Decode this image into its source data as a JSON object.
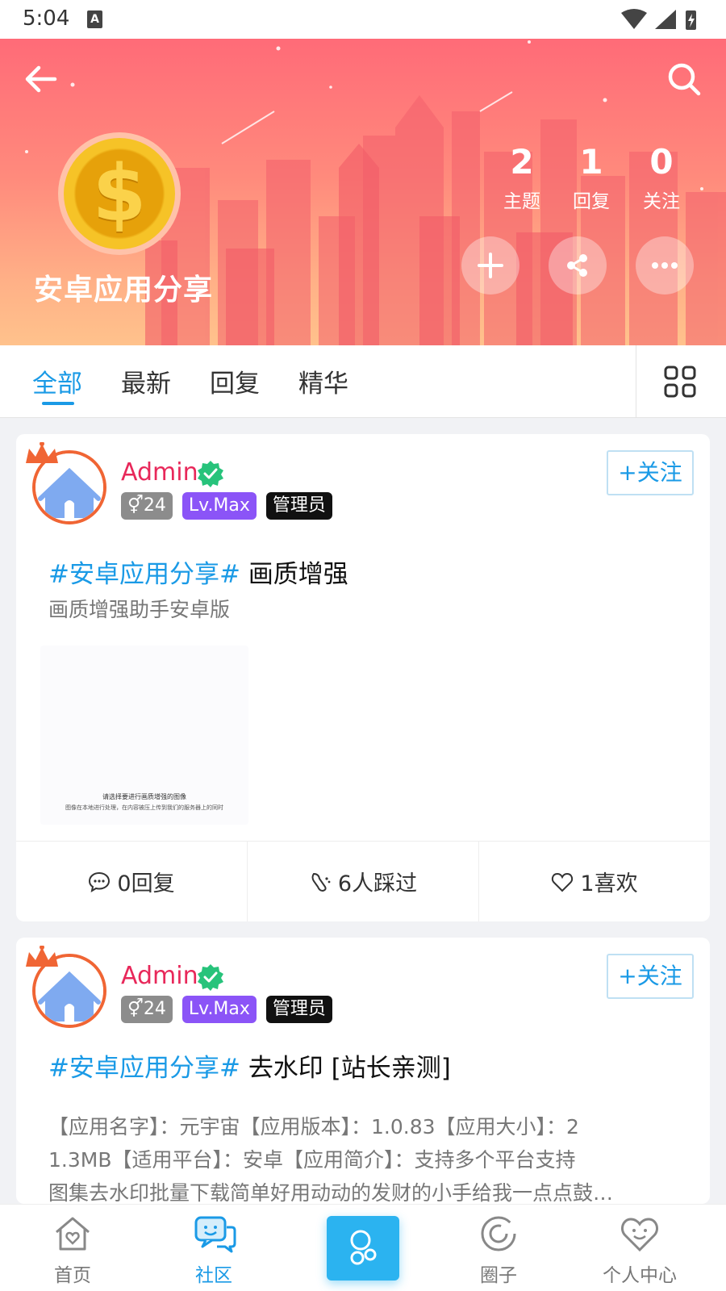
{
  "status_bar": {
    "time": "5:04",
    "notification_letter": "A"
  },
  "header": {
    "forum_name": "安卓应用分享",
    "avatar_icon": "dollar-coin-icon",
    "stats": [
      {
        "value": "2",
        "label": "主题"
      },
      {
        "value": "1",
        "label": "回复"
      },
      {
        "value": "0",
        "label": "关注"
      }
    ],
    "actions": [
      "plus-icon",
      "share-icon",
      "more-icon"
    ]
  },
  "tabs": {
    "items": [
      "全部",
      "最新",
      "回复",
      "精华"
    ],
    "active_index": 0
  },
  "posts": [
    {
      "author": "Admin",
      "gender_age": "24",
      "level": "Lv.Max",
      "role": "管理员",
      "follow_label": "+关注",
      "tag": "#安卓应用分享#",
      "title": "画质增强",
      "description": "画质增强助手安卓版",
      "thumbnail_line1": "请选择要进行画质增强的图像",
      "thumbnail_line2": "图像在本地进行处理，在内容被压上传到我们的服务器上的同时",
      "reply_count": "0回复",
      "view_count": "6人踩过",
      "like_count": "1喜欢"
    },
    {
      "author": "Admin",
      "gender_age": "24",
      "level": "Lv.Max",
      "role": "管理员",
      "follow_label": "+关注",
      "tag": "#安卓应用分享#",
      "title": "去水印 [站长亲测]",
      "description_line1": "【应用名字】：元宇宙【应用版本】：1.0.83【应用大小】：2",
      "description_line2": "1.3MB【适用平台】：安卓【应用简介】：支持多个平台支持",
      "description_line3": "图集去水印批量下载简单好用动动的发财的小手给我一点点鼓…"
    }
  ],
  "bottom_nav": {
    "items": [
      "首页",
      "社区",
      "",
      "圈子",
      "个人中心"
    ],
    "active_index": 1
  },
  "colors": {
    "accent": "#1a9ae6",
    "author": "#e8285a",
    "level_badge": "#8b54f7",
    "hero_top": "#ff6b78",
    "hero_bottom": "#ffc28c"
  }
}
